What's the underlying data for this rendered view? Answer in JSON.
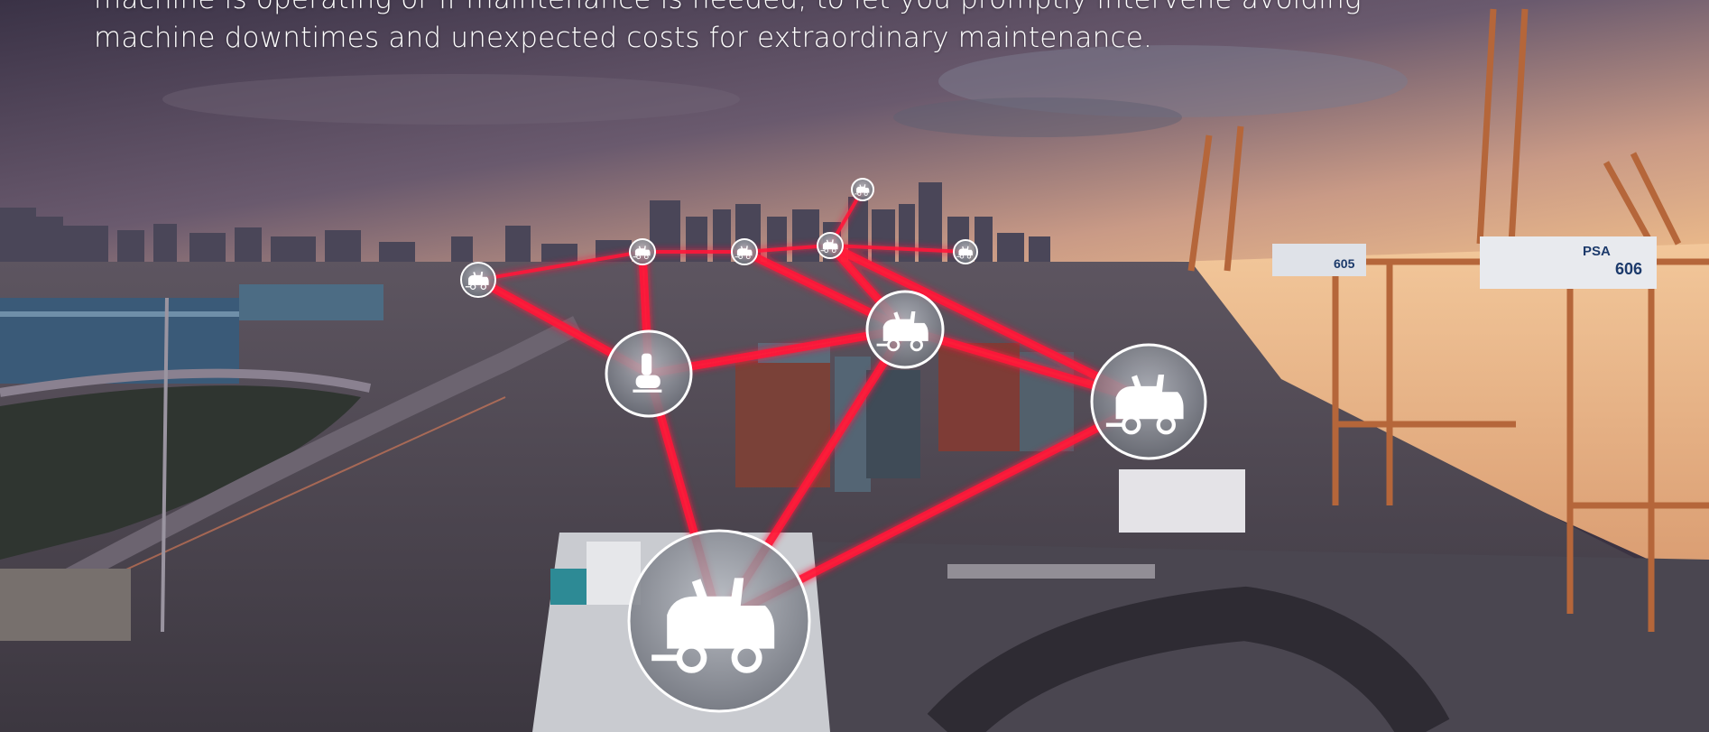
{
  "caption": {
    "line1": "machine is operating or if maintenance is needed, to let you promptly intervene avoiding",
    "line2": "machine downtimes and unexpected costs for extraordinary maintenance."
  },
  "colors": {
    "network_line": "#ff1a3a",
    "node_fill": "#9aa0a8",
    "node_ring": "#ffffff",
    "sky_top": "#3d3448",
    "sky_horizon": "#e7b38a"
  },
  "photo": {
    "crane_labels": [
      "605",
      "606"
    ],
    "brand_label": "PSA"
  },
  "nodes": [
    {
      "kind": "small",
      "icon": "machine-icon"
    },
    {
      "kind": "small",
      "icon": "machine-icon"
    },
    {
      "kind": "small",
      "icon": "machine-icon"
    },
    {
      "kind": "small",
      "icon": "machine-icon"
    },
    {
      "kind": "small",
      "icon": "machine-icon"
    },
    {
      "kind": "small",
      "icon": "machine-icon"
    },
    {
      "kind": "medium",
      "icon": "scrubber-walk-behind-icon"
    },
    {
      "kind": "medium",
      "icon": "ride-on-sweeper-icon"
    },
    {
      "kind": "medium",
      "icon": "ride-on-scrubber-icon"
    },
    {
      "kind": "large",
      "icon": "ride-on-scrubber-icon"
    }
  ]
}
